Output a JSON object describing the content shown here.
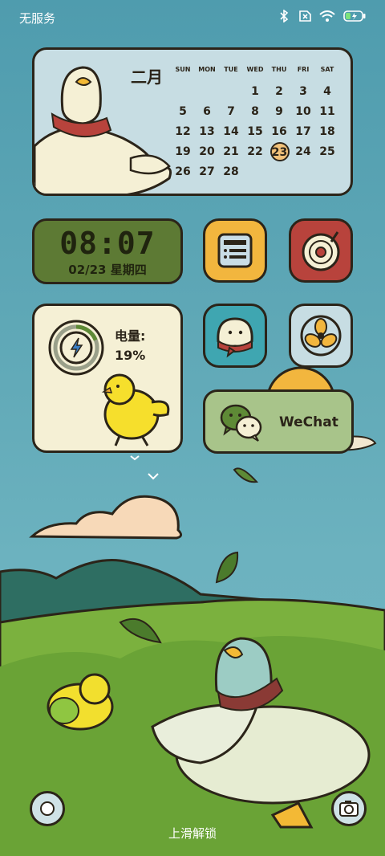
{
  "status_bar": {
    "carrier": "无服务"
  },
  "calendar": {
    "month": "二月",
    "weekdays": [
      "SUN",
      "MON",
      "TUE",
      "WED",
      "THU",
      "FRI",
      "SAT"
    ],
    "weeks": [
      [
        "",
        "",
        "",
        "1",
        "2",
        "3",
        "4"
      ],
      [
        "5",
        "6",
        "7",
        "8",
        "9",
        "10",
        "11"
      ],
      [
        "12",
        "13",
        "14",
        "15",
        "16",
        "17",
        "18"
      ],
      [
        "19",
        "20",
        "21",
        "22",
        "23",
        "24",
        "25"
      ],
      [
        "26",
        "27",
        "28",
        "",
        "",
        "",
        ""
      ]
    ],
    "today": "23"
  },
  "clock": {
    "time": "08:07",
    "date": "02/23 星期四"
  },
  "battery": {
    "label": "电量:",
    "percent": "19%",
    "level": 0.19
  },
  "wechat": {
    "label": "WeChat"
  },
  "lockscreen": {
    "unlock_hint": "上滑解锁"
  },
  "colors": {
    "outline": "#2b2419",
    "clock_bg": "#5d7a34",
    "calendar_bg": "#c7dde3",
    "grass": "#7bb13e"
  }
}
